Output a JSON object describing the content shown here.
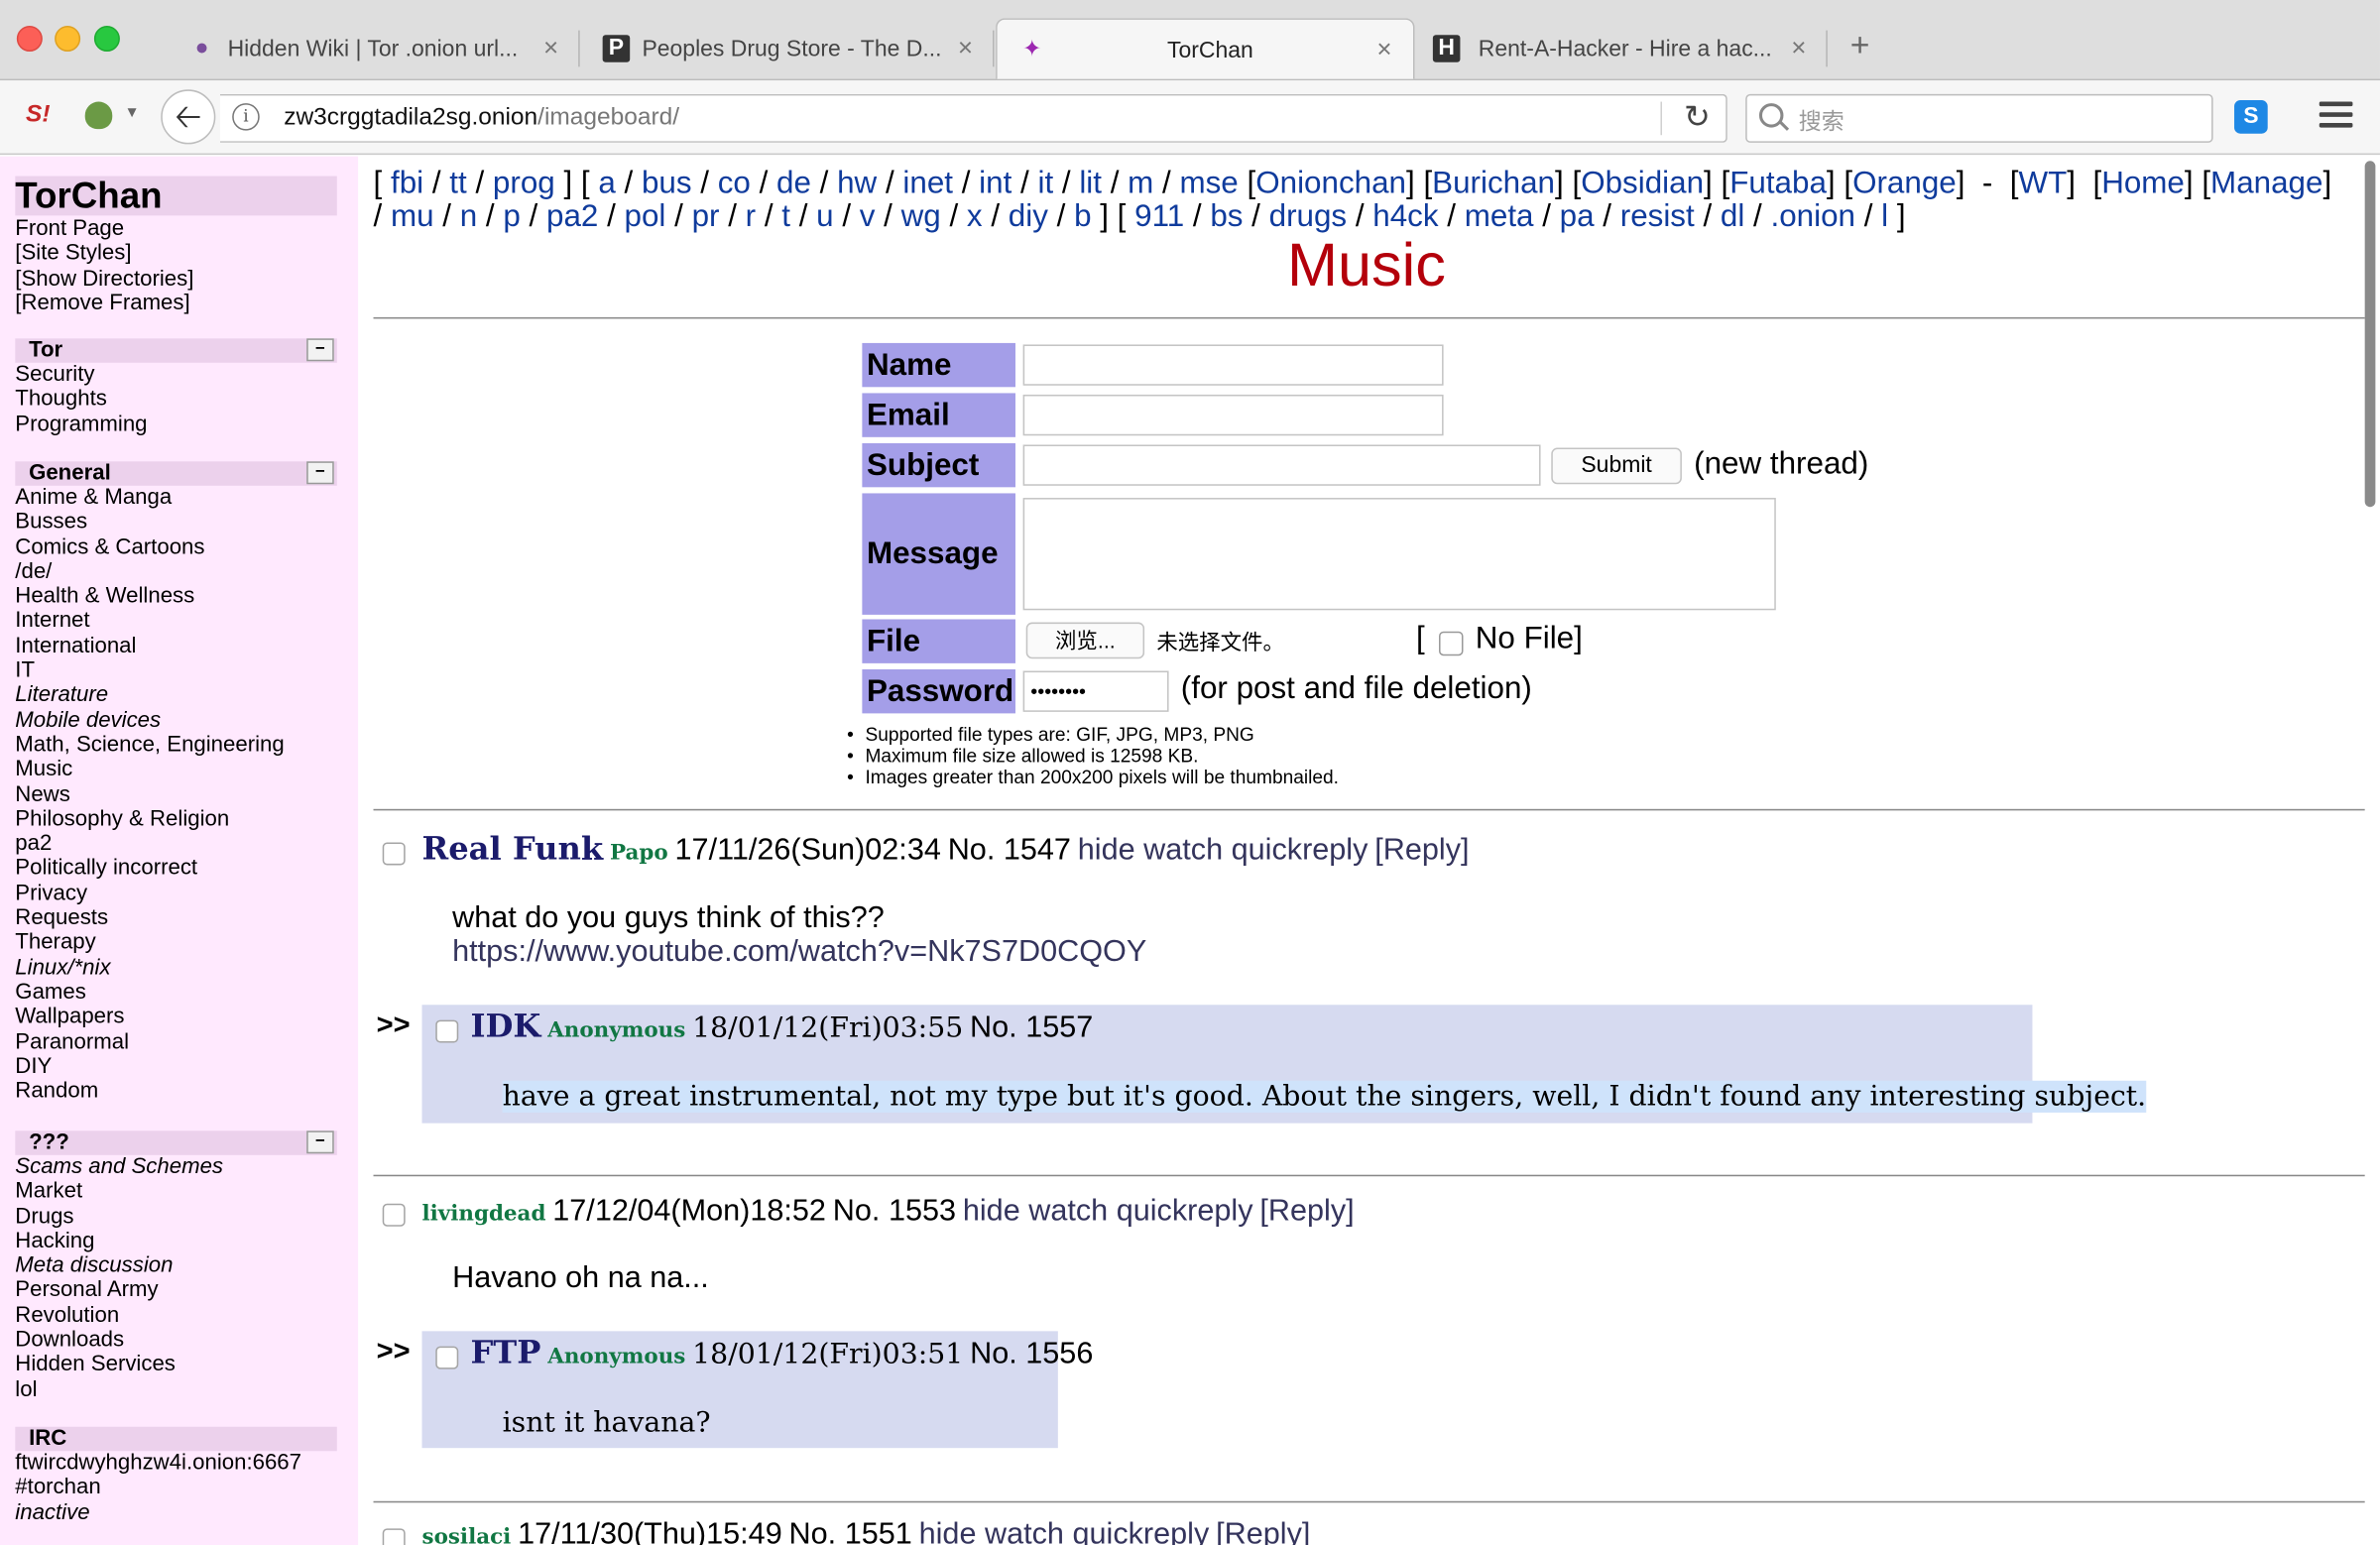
{
  "browser": {
    "tabs": [
      {
        "title": "Hidden Wiki | Tor .onion url...",
        "icon": "onion-icon"
      },
      {
        "title": "Peoples Drug Store - The D...",
        "icon": "p-logo-icon"
      },
      {
        "title": "TorChan",
        "icon": "torchan-icon"
      },
      {
        "title": "Rent-A-Hacker - Hire a hac...",
        "icon": "h-logo-icon"
      }
    ],
    "close_glyph": "×",
    "new_tab_glyph": "+",
    "url_host": "zw3crggtadila2sg.onion",
    "url_path": "/imageboard/",
    "search_placeholder": "搜索",
    "addon_s_label": "S",
    "addon_logo_label": "S!"
  },
  "sidebar": {
    "brand": "TorChan",
    "links": [
      "Front Page",
      "[Site Styles]",
      "[Show Directories]",
      "[Remove Frames]"
    ],
    "toggle_label": "−",
    "sections": [
      {
        "title": "Tor",
        "items": [
          {
            "label": "Security",
            "italic": false
          },
          {
            "label": "Thoughts",
            "italic": false
          },
          {
            "label": "Programming",
            "italic": false
          }
        ]
      },
      {
        "title": "General",
        "items": [
          {
            "label": "Anime & Manga",
            "italic": false
          },
          {
            "label": "Busses",
            "italic": false
          },
          {
            "label": "Comics & Cartoons",
            "italic": false
          },
          {
            "label": "/de/",
            "italic": false
          },
          {
            "label": "Health & Wellness",
            "italic": false
          },
          {
            "label": "Internet",
            "italic": false
          },
          {
            "label": "International",
            "italic": false
          },
          {
            "label": "IT",
            "italic": false
          },
          {
            "label": "Literature",
            "italic": true
          },
          {
            "label": "Mobile devices",
            "italic": true
          },
          {
            "label": "Math, Science, Engineering",
            "italic": false
          },
          {
            "label": "Music",
            "italic": false
          },
          {
            "label": "News",
            "italic": false
          },
          {
            "label": "Philosophy & Religion",
            "italic": false
          },
          {
            "label": "pa2",
            "italic": false
          },
          {
            "label": "Politically incorrect",
            "italic": false
          },
          {
            "label": "Privacy",
            "italic": false
          },
          {
            "label": "Requests",
            "italic": false
          },
          {
            "label": "Therapy",
            "italic": false
          },
          {
            "label": "Linux/*nix",
            "italic": true
          },
          {
            "label": "Games",
            "italic": false
          },
          {
            "label": "Wallpapers",
            "italic": false
          },
          {
            "label": "Paranormal",
            "italic": false
          },
          {
            "label": "DIY",
            "italic": false
          },
          {
            "label": "Random",
            "italic": false
          }
        ]
      },
      {
        "title": "???",
        "items": [
          {
            "label": "Scams and Schemes",
            "italic": true
          },
          {
            "label": "Market",
            "italic": false
          },
          {
            "label": "Drugs",
            "italic": false
          },
          {
            "label": "Hacking",
            "italic": false
          },
          {
            "label": "Meta discussion",
            "italic": true
          },
          {
            "label": "Personal Army",
            "italic": false
          },
          {
            "label": "Revolution",
            "italic": false
          },
          {
            "label": "Downloads",
            "italic": false
          },
          {
            "label": "Hidden Services",
            "italic": false
          },
          {
            "label": "lol",
            "italic": false
          }
        ]
      },
      {
        "title": "IRC",
        "items": [
          {
            "label": "ftwircdwyhghzw4i.onion:6667",
            "italic": false
          },
          {
            "label": "#torchan",
            "italic": false
          },
          {
            "label": "inactive",
            "italic": true
          }
        ]
      }
    ]
  },
  "boardnav": {
    "line1": [
      {
        "t": "[ ",
        "l": false
      },
      {
        "t": "fbi",
        "l": true
      },
      {
        "t": " / ",
        "l": false
      },
      {
        "t": "tt",
        "l": true
      },
      {
        "t": " / ",
        "l": false
      },
      {
        "t": "prog",
        "l": true
      },
      {
        "t": " ] [ ",
        "l": false
      },
      {
        "t": "a",
        "l": true
      },
      {
        "t": " / ",
        "l": false
      },
      {
        "t": "bus",
        "l": true
      },
      {
        "t": " / ",
        "l": false
      },
      {
        "t": "co",
        "l": true
      },
      {
        "t": " / ",
        "l": false
      },
      {
        "t": "de",
        "l": true
      },
      {
        "t": " / ",
        "l": false
      },
      {
        "t": "hw",
        "l": true
      },
      {
        "t": " / ",
        "l": false
      },
      {
        "t": "inet",
        "l": true
      },
      {
        "t": " / ",
        "l": false
      },
      {
        "t": "int",
        "l": true
      },
      {
        "t": " / ",
        "l": false
      },
      {
        "t": "it",
        "l": true
      },
      {
        "t": " / ",
        "l": false
      },
      {
        "t": "lit",
        "l": true
      },
      {
        "t": " / ",
        "l": false
      },
      {
        "t": "m",
        "l": true
      },
      {
        "t": " / ",
        "l": false
      },
      {
        "t": "mse",
        "l": true
      },
      {
        "t": " [",
        "l": false
      },
      {
        "t": "Onionchan",
        "l": true
      },
      {
        "t": "] [",
        "l": false
      },
      {
        "t": "Burichan",
        "l": true
      },
      {
        "t": "] [",
        "l": false
      },
      {
        "t": "Obsidian",
        "l": true
      },
      {
        "t": "] [",
        "l": false
      },
      {
        "t": "Futaba",
        "l": true
      },
      {
        "t": "] [",
        "l": false
      },
      {
        "t": "Orange",
        "l": true
      },
      {
        "t": "]  -  [",
        "l": false
      },
      {
        "t": "WT",
        "l": true
      },
      {
        "t": "]  [",
        "l": false
      },
      {
        "t": "Home",
        "l": true
      },
      {
        "t": "] [",
        "l": false
      },
      {
        "t": "Manage",
        "l": true
      },
      {
        "t": "]",
        "l": false
      }
    ],
    "line2": [
      {
        "t": "/ ",
        "l": false
      },
      {
        "t": "mu",
        "l": true
      },
      {
        "t": " / ",
        "l": false
      },
      {
        "t": "n",
        "l": true
      },
      {
        "t": " / ",
        "l": false
      },
      {
        "t": "p",
        "l": true
      },
      {
        "t": " / ",
        "l": false
      },
      {
        "t": "pa2",
        "l": true
      },
      {
        "t": " / ",
        "l": false
      },
      {
        "t": "pol",
        "l": true
      },
      {
        "t": " / ",
        "l": false
      },
      {
        "t": "pr",
        "l": true
      },
      {
        "t": " / ",
        "l": false
      },
      {
        "t": "r",
        "l": true
      },
      {
        "t": " / ",
        "l": false
      },
      {
        "t": "t",
        "l": true
      },
      {
        "t": " / ",
        "l": false
      },
      {
        "t": "u",
        "l": true
      },
      {
        "t": " / ",
        "l": false
      },
      {
        "t": "v",
        "l": true
      },
      {
        "t": " / ",
        "l": false
      },
      {
        "t": "wg",
        "l": true
      },
      {
        "t": " / ",
        "l": false
      },
      {
        "t": "x",
        "l": true
      },
      {
        "t": " / ",
        "l": false
      },
      {
        "t": "diy",
        "l": true
      },
      {
        "t": " / ",
        "l": false
      },
      {
        "t": "b",
        "l": true
      },
      {
        "t": " ] [ ",
        "l": false
      },
      {
        "t": "911",
        "l": true
      },
      {
        "t": " / ",
        "l": false
      },
      {
        "t": "bs",
        "l": true
      },
      {
        "t": " / ",
        "l": false
      },
      {
        "t": "drugs",
        "l": true
      },
      {
        "t": " / ",
        "l": false
      },
      {
        "t": "h4ck",
        "l": true
      },
      {
        "t": " / ",
        "l": false
      },
      {
        "t": "meta",
        "l": true
      },
      {
        "t": " / ",
        "l": false
      },
      {
        "t": "pa",
        "l": true
      },
      {
        "t": " / ",
        "l": false
      },
      {
        "t": "resist",
        "l": true
      },
      {
        "t": " / ",
        "l": false
      },
      {
        "t": "dl",
        "l": true
      },
      {
        "t": " / ",
        "l": false
      },
      {
        "t": ".onion",
        "l": true
      },
      {
        "t": " / ",
        "l": false
      },
      {
        "t": "l",
        "l": true
      },
      {
        "t": " ]",
        "l": false
      }
    ]
  },
  "board_title": "Music",
  "form": {
    "name_label": "Name",
    "email_label": "Email",
    "subject_label": "Subject",
    "submit_label": "Submit",
    "new_thread_note": "(new thread)",
    "message_label": "Message",
    "file_label": "File",
    "browse_label": "浏览...",
    "no_file_selected": "未选择文件。",
    "nofile_open": "[",
    "nofile_label": "No File]",
    "password_label": "Password",
    "password_value": "••••••••",
    "password_note": "(for post and file deletion)",
    "rules": [
      "Supported file types are: GIF, JPG, MP3, PNG",
      "Maximum file size allowed is 12598 KB.",
      "Images greater than 200x200 pixels will be thumbnailed."
    ]
  },
  "threads": [
    {
      "subject": "Real Funk",
      "name": "Papo",
      "date": "17/11/26(Sun)02:34",
      "no": "No. 1547",
      "links": "hide watch quickreply",
      "reply_link": "[Reply]",
      "body": [
        "what do you guys think of this??",
        "https://www.youtube.com/watch?v=Nk7S7D0CQOY"
      ],
      "replies": [
        {
          "arrows": ">>",
          "subject": "IDK",
          "name": "Anonymous",
          "date": "18/01/12(Fri)03:55",
          "no": "No. 1557",
          "body": "have a great instrumental, not my type but it's good. About the singers, well, I didn't found any interesting subject."
        }
      ]
    },
    {
      "subject": "",
      "name": "livingdead",
      "date": "17/12/04(Mon)18:52",
      "no": "No. 1553",
      "links": "hide watch quickreply",
      "reply_link": "[Reply]",
      "body": [
        "Havano oh na na..."
      ],
      "replies": [
        {
          "arrows": ">>",
          "subject": "FTP",
          "name": "Anonymous",
          "date": "18/01/12(Fri)03:51",
          "no": "No. 1556",
          "body": "isnt it havana?"
        }
      ]
    },
    {
      "subject": "",
      "name": "sosilaci",
      "date": "17/11/30(Thu)15:49",
      "no": "No. 1551",
      "links": "hide watch quickreply",
      "reply_link": "[Reply]",
      "body": [],
      "replies": []
    }
  ]
}
